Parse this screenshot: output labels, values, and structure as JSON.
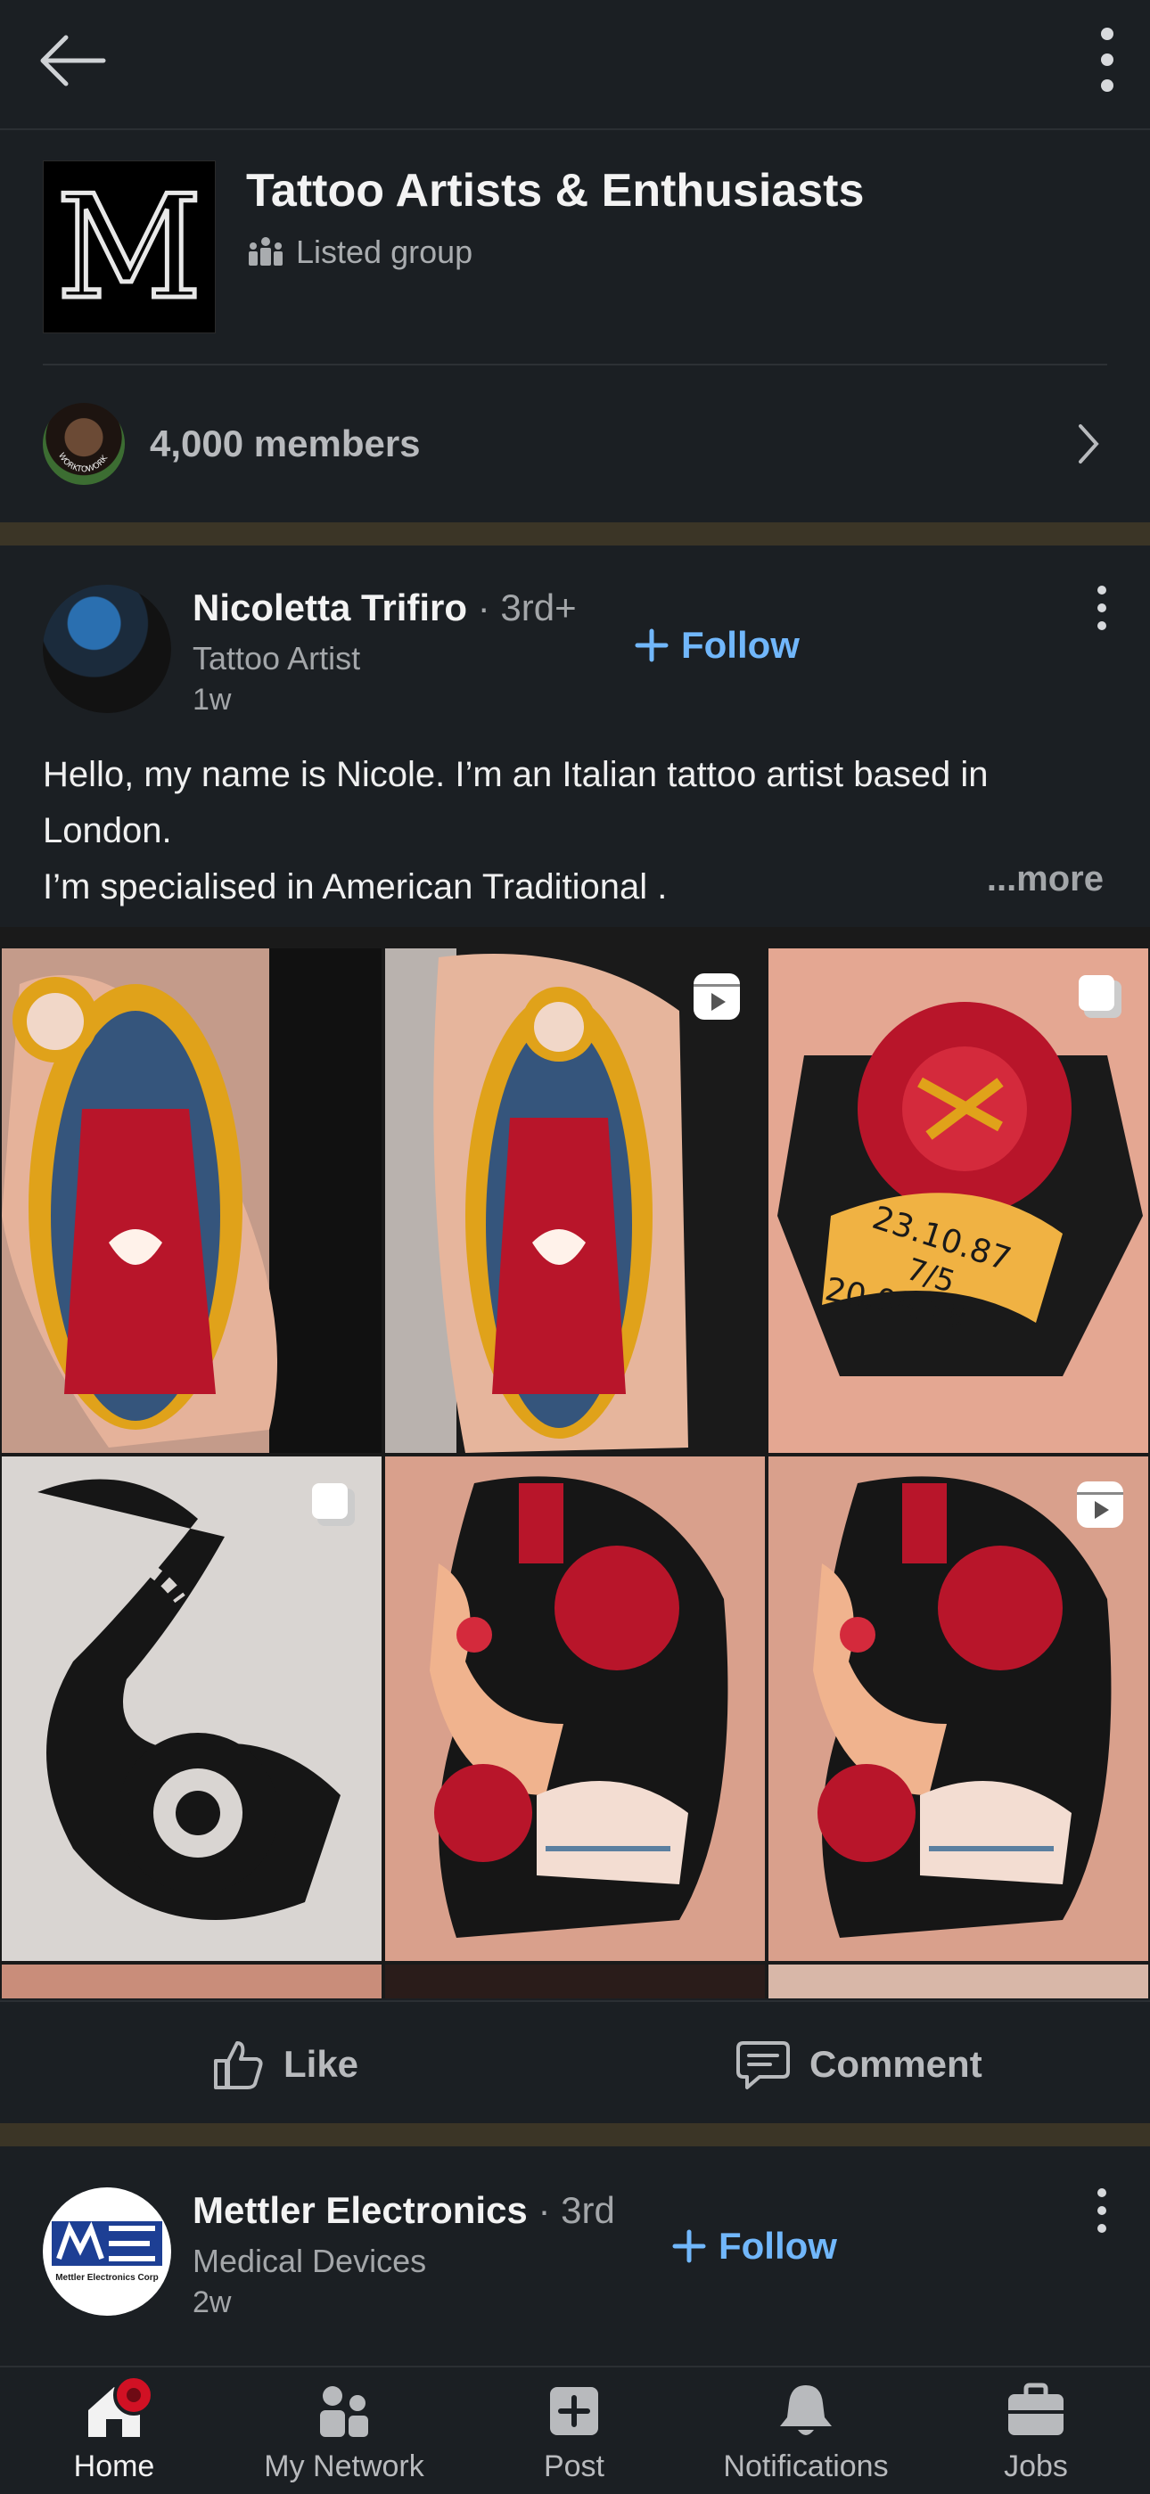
{
  "top_bar": {
    "back_icon": "arrow-left-icon",
    "menu_icon": "more-vertical-icon"
  },
  "group": {
    "logo_letter": "M",
    "name": "Tattoo Artists & Enthusiasts",
    "visibility": "Listed group",
    "members": "4,000 members",
    "avatar_badge_text": "WORKTOWORK"
  },
  "post1": {
    "author": "Nicoletta Trifiro",
    "degree": "· 3rd+",
    "headline": "Tattoo Artist",
    "time": "1w",
    "follow_label": "Follow",
    "text_lines": [
      "Hello, my name is Nicole. I’m an Italian tattoo artist based in",
      "London.",
      "I’m specialised in American Traditional ."
    ],
    "more_label": "...more",
    "tiles": [
      {
        "subject": "virgin-mary-tattoo",
        "overlay_icon": ""
      },
      {
        "subject": "virgin-mary-tattoo",
        "overlay_icon": "reel-icon"
      },
      {
        "subject": "rose-banner-tattoo",
        "overlay_icon": "carousel-icon",
        "banner_text": [
          "23.10.87",
          "7/5",
          "20.08.16"
        ]
      },
      {
        "subject": "snake-rose-tattoo",
        "overlay_icon": "carousel-icon"
      },
      {
        "subject": "lady-head-tattoo",
        "overlay_icon": ""
      },
      {
        "subject": "lady-head-tattoo",
        "overlay_icon": "reel-icon"
      }
    ]
  },
  "actions": {
    "like_label": "Like",
    "comment_label": "Comment"
  },
  "post2": {
    "author": "Mettler Electronics",
    "degree": "· 3rd",
    "headline": "Medical Devices",
    "time": "2w",
    "follow_label": "Follow",
    "logo_caption": "Mettler Electronics Corp"
  },
  "nav": [
    {
      "label": "Home",
      "icon": "home-icon"
    },
    {
      "label": "My Network",
      "icon": "network-icon"
    },
    {
      "label": "Post",
      "icon": "post-icon"
    },
    {
      "label": "Notifications",
      "icon": "bell-icon"
    },
    {
      "label": "Jobs",
      "icon": "briefcase-icon"
    }
  ],
  "colors": {
    "background": "#1b1f23",
    "accent": "#71b7fb",
    "separator": "#3b3526",
    "badge": "#d11124"
  }
}
